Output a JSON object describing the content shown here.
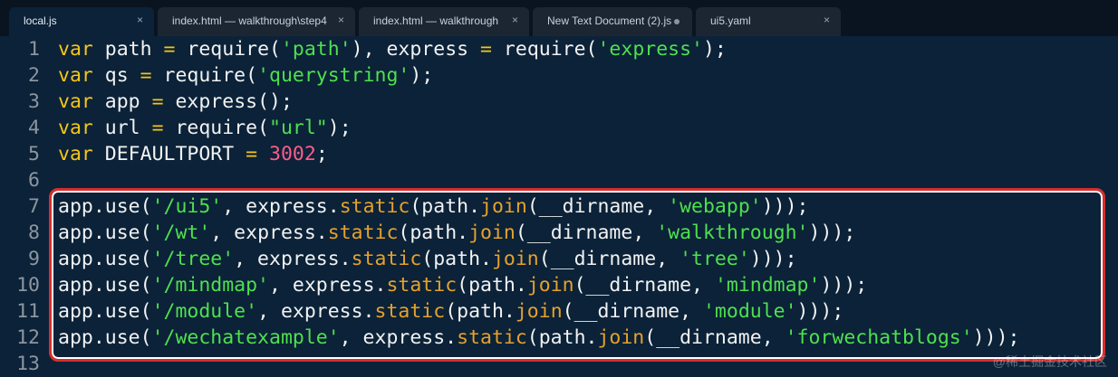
{
  "tabs": [
    {
      "label": "local.js",
      "active": true,
      "close": "×"
    },
    {
      "label": "index.html — walkthrough\\step4",
      "active": false,
      "close": "×"
    },
    {
      "label": "index.html — walkthrough",
      "active": false,
      "close": "×"
    },
    {
      "label": "New Text Document (2).js",
      "active": false,
      "modified": true
    },
    {
      "label": "ui5.yaml",
      "active": false,
      "close": "×"
    }
  ],
  "colors": {
    "background": "#0b2238",
    "keyword": "#f5c518",
    "string": "#4ee04e",
    "number": "#ff5c8a",
    "function": "#e6a12b",
    "highlight_border": "#d72e2e"
  },
  "lines": [
    {
      "n": "1",
      "tokens": [
        [
          "kw",
          "var"
        ],
        [
          "p",
          " path "
        ],
        [
          "kw",
          "="
        ],
        [
          "p",
          " require("
        ],
        [
          "str",
          "'path'"
        ],
        [
          "p",
          "), express "
        ],
        [
          "kw",
          "="
        ],
        [
          "p",
          " require("
        ],
        [
          "str",
          "'express'"
        ],
        [
          "p",
          ");"
        ]
      ]
    },
    {
      "n": "2",
      "tokens": [
        [
          "kw",
          "var"
        ],
        [
          "p",
          " qs "
        ],
        [
          "kw",
          "="
        ],
        [
          "p",
          " require("
        ],
        [
          "str",
          "'querystring'"
        ],
        [
          "p",
          ");"
        ]
      ]
    },
    {
      "n": "3",
      "tokens": [
        [
          "kw",
          "var"
        ],
        [
          "p",
          " app "
        ],
        [
          "kw",
          "="
        ],
        [
          "p",
          " express();"
        ]
      ]
    },
    {
      "n": "4",
      "tokens": [
        [
          "kw",
          "var"
        ],
        [
          "p",
          " url "
        ],
        [
          "kw",
          "="
        ],
        [
          "p",
          " require("
        ],
        [
          "str",
          "\"url\""
        ],
        [
          "p",
          ");"
        ]
      ]
    },
    {
      "n": "5",
      "tokens": [
        [
          "kw",
          "var"
        ],
        [
          "p",
          " DEFAULTPORT "
        ],
        [
          "kw",
          "="
        ],
        [
          "p",
          " "
        ],
        [
          "num",
          "3002"
        ],
        [
          "p",
          ";"
        ]
      ]
    },
    {
      "n": "6",
      "tokens": []
    },
    {
      "n": "7",
      "tokens": [
        [
          "p",
          "app.use("
        ],
        [
          "str",
          "'/ui5'"
        ],
        [
          "p",
          ", express."
        ],
        [
          "fn",
          "static"
        ],
        [
          "p",
          "(path."
        ],
        [
          "fn",
          "join"
        ],
        [
          "p",
          "(__dirname, "
        ],
        [
          "str",
          "'webapp'"
        ],
        [
          "p",
          ")));"
        ]
      ]
    },
    {
      "n": "8",
      "tokens": [
        [
          "p",
          "app.use("
        ],
        [
          "str",
          "'/wt'"
        ],
        [
          "p",
          ", express."
        ],
        [
          "fn",
          "static"
        ],
        [
          "p",
          "(path."
        ],
        [
          "fn",
          "join"
        ],
        [
          "p",
          "(__dirname, "
        ],
        [
          "str",
          "'walkthrough'"
        ],
        [
          "p",
          ")));"
        ]
      ]
    },
    {
      "n": "9",
      "tokens": [
        [
          "p",
          "app.use("
        ],
        [
          "str",
          "'/tree'"
        ],
        [
          "p",
          ", express."
        ],
        [
          "fn",
          "static"
        ],
        [
          "p",
          "(path."
        ],
        [
          "fn",
          "join"
        ],
        [
          "p",
          "(__dirname, "
        ],
        [
          "str",
          "'tree'"
        ],
        [
          "p",
          ")));"
        ]
      ]
    },
    {
      "n": "10",
      "tokens": [
        [
          "p",
          "app.use("
        ],
        [
          "str",
          "'/mindmap'"
        ],
        [
          "p",
          ", express."
        ],
        [
          "fn",
          "static"
        ],
        [
          "p",
          "(path."
        ],
        [
          "fn",
          "join"
        ],
        [
          "p",
          "(__dirname, "
        ],
        [
          "str",
          "'mindmap'"
        ],
        [
          "p",
          ")));"
        ]
      ]
    },
    {
      "n": "11",
      "tokens": [
        [
          "p",
          "app.use("
        ],
        [
          "str",
          "'/module'"
        ],
        [
          "p",
          ", express."
        ],
        [
          "fn",
          "static"
        ],
        [
          "p",
          "(path."
        ],
        [
          "fn",
          "join"
        ],
        [
          "p",
          "(__dirname, "
        ],
        [
          "str",
          "'module'"
        ],
        [
          "p",
          ")));"
        ]
      ]
    },
    {
      "n": "12",
      "tokens": [
        [
          "p",
          "app.use("
        ],
        [
          "str",
          "'/wechatexample'"
        ],
        [
          "p",
          ", express."
        ],
        [
          "fn",
          "static"
        ],
        [
          "p",
          "(path."
        ],
        [
          "fn",
          "join"
        ],
        [
          "p",
          "(__dirname, "
        ],
        [
          "str",
          "'forwechatblogs'"
        ],
        [
          "p",
          ")));"
        ]
      ]
    },
    {
      "n": "13",
      "tokens": []
    }
  ],
  "watermark": "@稀土掘金技术社区"
}
